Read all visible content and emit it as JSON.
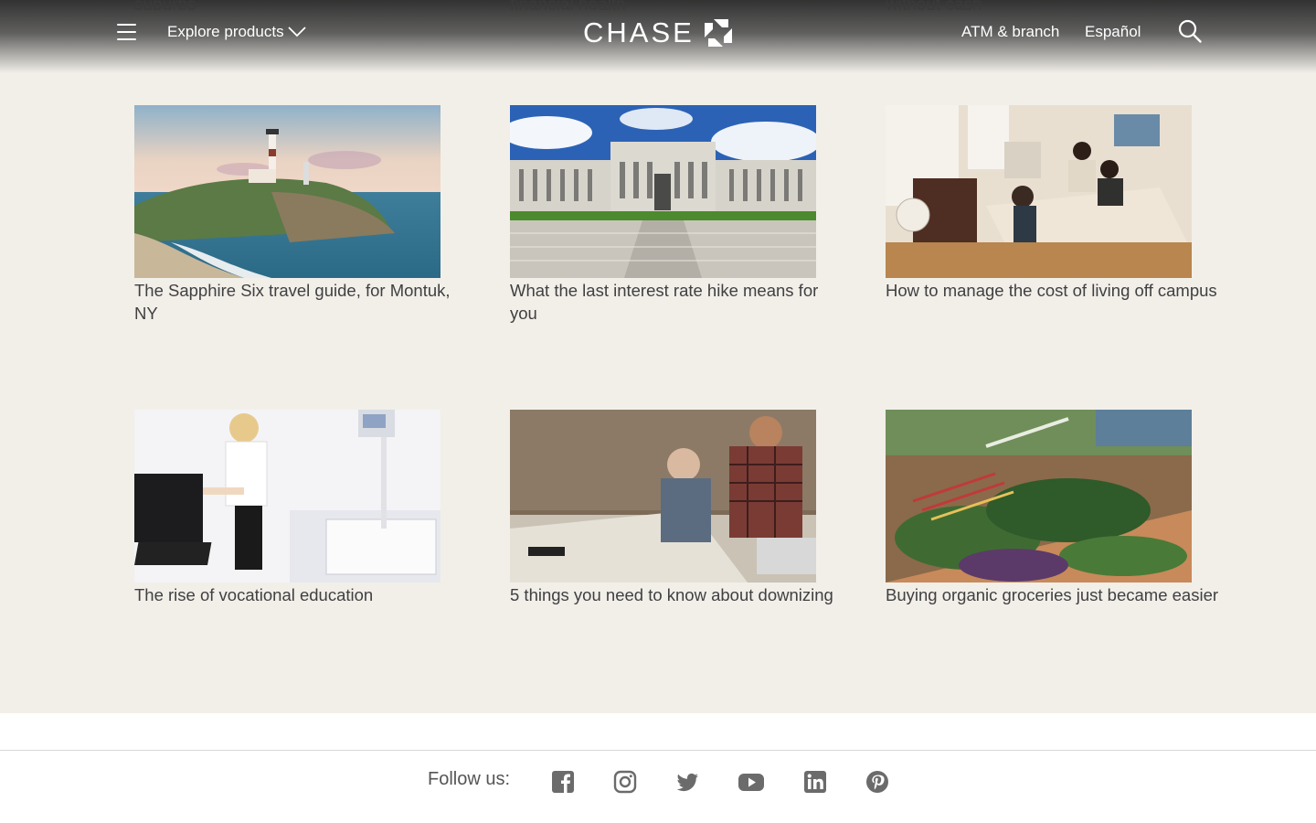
{
  "header": {
    "peek_texts": [
      "suburbs",
      "financial health",
      "without cash"
    ],
    "explore_label": "Explore products",
    "logo_text": "CHASE",
    "atm_label": "ATM & branch",
    "espanol_label": "Español"
  },
  "articles": [
    {
      "caption": "The Sapphire Six travel guide, for Montuk, NY",
      "image": "lighthouse-photo"
    },
    {
      "caption": "What the last interest rate hike means for you",
      "image": "federal-building-photo"
    },
    {
      "caption": "How to manage the cost of living off campus",
      "image": "students-room-photo"
    },
    {
      "caption": "The rise of vocational education",
      "image": "technician-photo"
    },
    {
      "caption": "5 things you need to know about downizing",
      "image": "men-at-table-photo"
    },
    {
      "caption": "Buying organic groceries just became easier",
      "image": "vegetables-photo"
    }
  ],
  "footer": {
    "follow_label": "Follow us:",
    "social": [
      "facebook-icon",
      "instagram-icon",
      "twitter-icon",
      "youtube-icon",
      "linkedin-icon",
      "pinterest-icon"
    ]
  },
  "colors": {
    "background": "#f2efe9",
    "text": "#414042",
    "icon_gray": "#6b6b6b"
  }
}
